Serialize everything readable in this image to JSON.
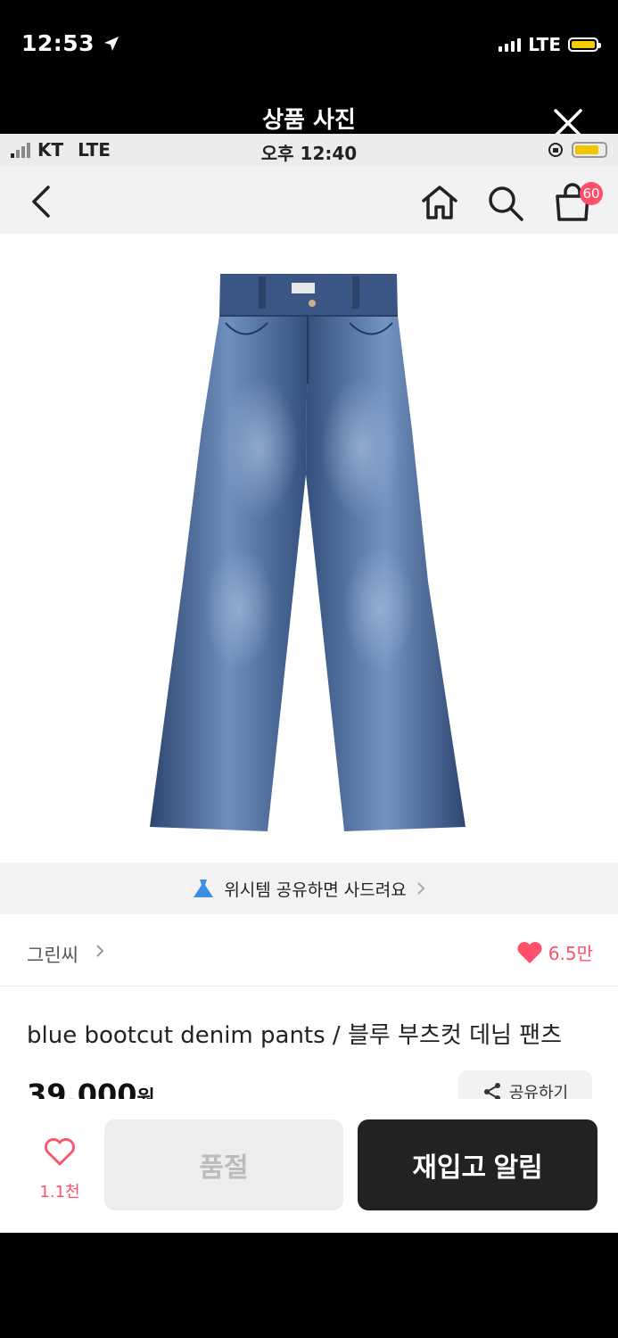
{
  "outer_status": {
    "time": "12:53",
    "network": "LTE"
  },
  "viewer": {
    "title": "상품 사진"
  },
  "inner_status": {
    "carrier": "KT",
    "network": "LTE",
    "time": "오후 12:40"
  },
  "nav": {
    "cart_count": "60"
  },
  "banner": {
    "text": "위시템 공유하면 사드려요"
  },
  "brand": {
    "name": "그린씨",
    "likes": "6.5만"
  },
  "product": {
    "title": "blue bootcut denim pants / 블루 부츠컷 데님 팬츠",
    "price": "39,000",
    "currency": "원",
    "share_label": "공유하기"
  },
  "bottom": {
    "wish_count": "1.1천",
    "soldout_label": "품절",
    "restock_label": "재입고 알림"
  },
  "colors": {
    "accent": "#ff4f6a",
    "denim": "#3e5a85",
    "battery": "#f6cc00"
  }
}
